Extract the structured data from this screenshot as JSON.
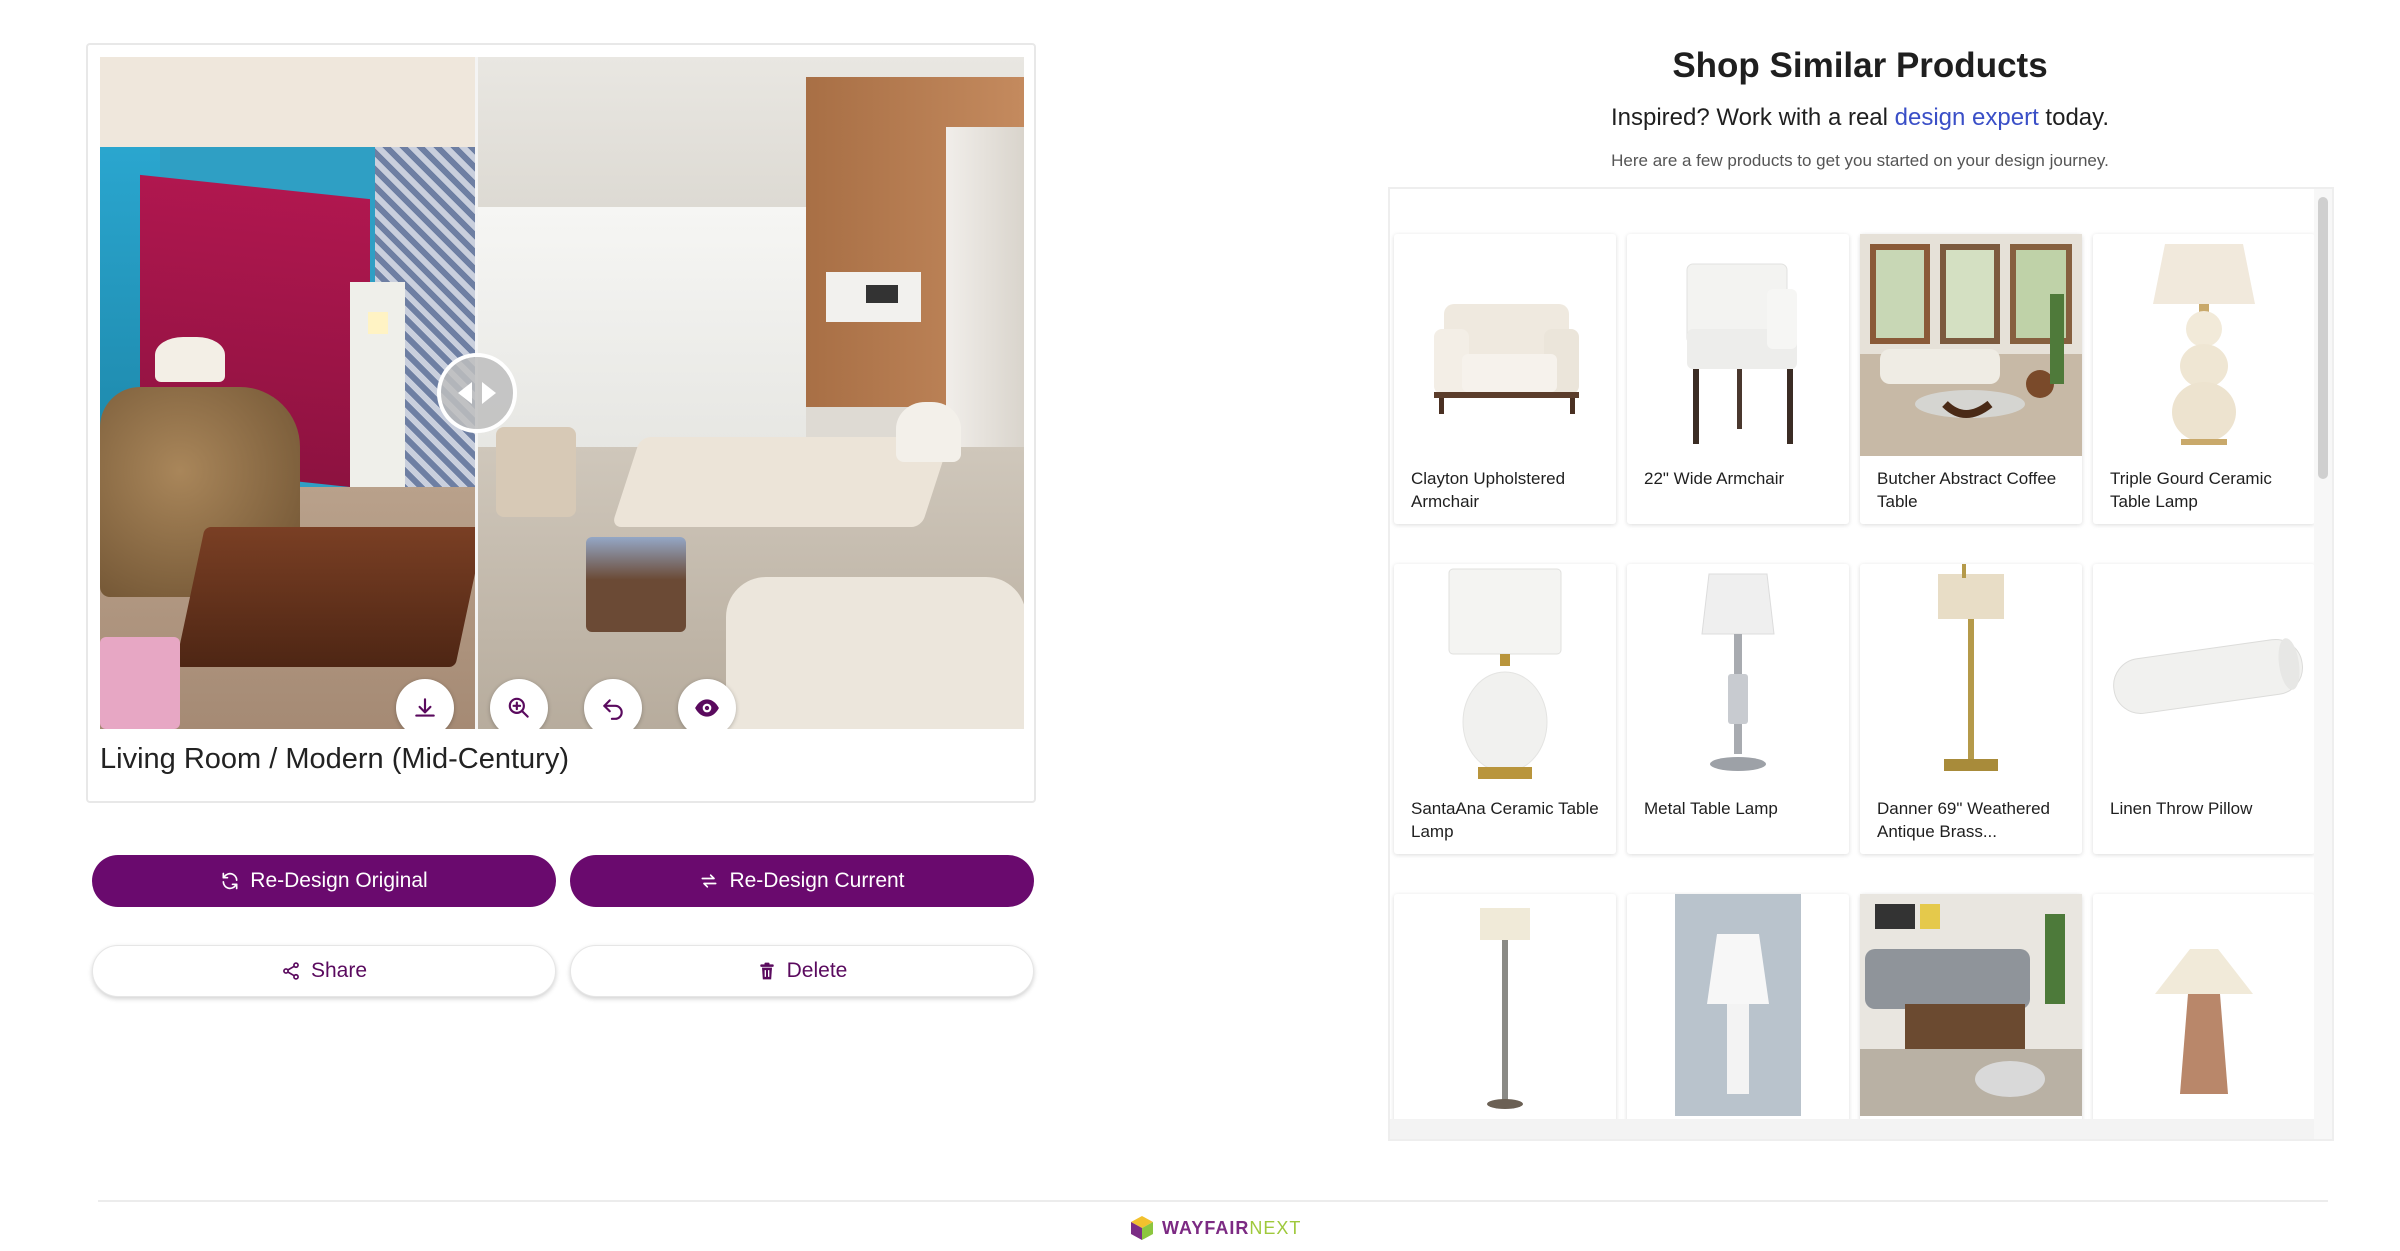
{
  "viewer": {
    "caption": "Living Room / Modern (Mid-Century)",
    "tools": [
      "download-icon",
      "zoom-in-icon",
      "undo-icon",
      "eye-icon"
    ]
  },
  "actions": {
    "redesign_original": "Re-Design Original",
    "redesign_current": "Re-Design Current",
    "share": "Share",
    "delete": "Delete"
  },
  "shop": {
    "title": "Shop Similar Products",
    "subtitle_pre": "Inspired? Work with a real",
    "subtitle_link": "design expert",
    "subtitle_post": "today.",
    "note": "Here are a few products to get you started on your design journey.",
    "products": [
      {
        "name": "Clayton Upholstered Armchair"
      },
      {
        "name": "22\" Wide Armchair"
      },
      {
        "name": "Butcher Abstract Coffee Table"
      },
      {
        "name": "Triple Gourd Ceramic Table Lamp"
      },
      {
        "name": "SantaAna Ceramic Table Lamp"
      },
      {
        "name": "Metal Table Lamp"
      },
      {
        "name": "Danner 69\" Weathered Antique Brass..."
      },
      {
        "name": "Linen Throw Pillow"
      },
      {
        "name": ""
      },
      {
        "name": ""
      },
      {
        "name": ""
      },
      {
        "name": ""
      }
    ]
  },
  "footer": {
    "brand": "WAYFAIR",
    "brand_suffix": "NEXT"
  },
  "colors": {
    "primary": "#6a0a6e",
    "link": "#3a4fc7",
    "brand_green": "#9fc93c"
  }
}
